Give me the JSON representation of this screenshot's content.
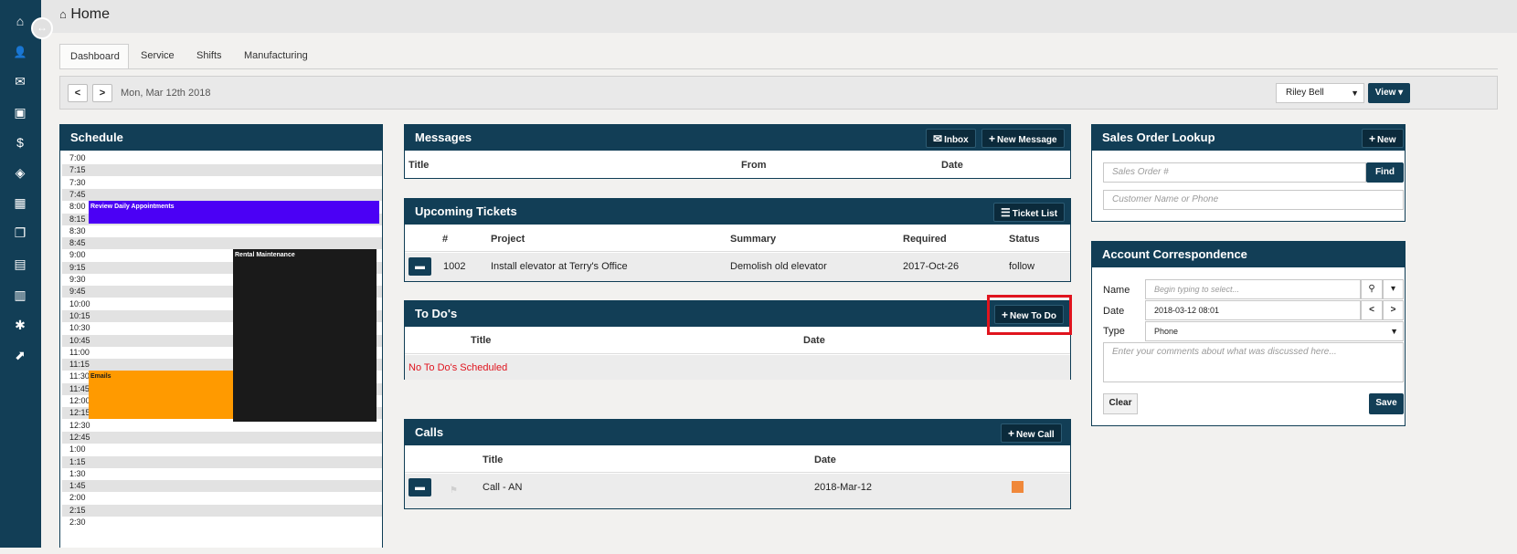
{
  "sidebar": {
    "icons": [
      "home-icon",
      "user-icon",
      "message-icon",
      "contact-icon",
      "dollar-icon",
      "tag-icon",
      "building-icon",
      "copy-icon",
      "chart-icon",
      "document-icon",
      "gear-icon",
      "external-link-icon"
    ],
    "glyphs": [
      "⌂",
      "👤",
      "✉",
      "▣",
      "$",
      "◈",
      "▦",
      "❐",
      "▤",
      "▥",
      "✱",
      "⬈"
    ],
    "collapse_glyph": "↔"
  },
  "header": {
    "home_glyph": "⌂",
    "title": "Home"
  },
  "tabs": [
    {
      "label": "Dashboard",
      "active": true
    },
    {
      "label": "Service",
      "active": false
    },
    {
      "label": "Shifts",
      "active": false
    },
    {
      "label": "Manufacturing",
      "active": false
    }
  ],
  "toolbar": {
    "prev": "<",
    "next": ">",
    "date": "Mon, Mar 12th 2018",
    "user": "Riley Bell",
    "user_arrow": "▼",
    "view_label": "View ▾"
  },
  "schedule": {
    "title": "Schedule",
    "times": [
      "7:00",
      "7:15",
      "7:30",
      "7:45",
      "8:00",
      "8:15",
      "8:30",
      "8:45",
      "9:00",
      "9:15",
      "9:30",
      "9:45",
      "10:00",
      "10:15",
      "10:30",
      "10:45",
      "11:00",
      "11:15",
      "11:30",
      "11:45",
      "12:00",
      "12:15",
      "12:30",
      "12:45",
      "1:00",
      "1:15",
      "1:30",
      "1:45",
      "2:00",
      "2:15",
      "2:30"
    ],
    "events": [
      {
        "label": "Review Daily Appointments",
        "color": "#4b00f5",
        "text_color": "#ffffff"
      },
      {
        "label": "Rental Maintenance",
        "color": "#1a1a1a",
        "text_color": "#ffffff"
      },
      {
        "label": "Emails",
        "color": "#ff9a00",
        "text_color": "#1a1a1a"
      }
    ]
  },
  "messages": {
    "title": "Messages",
    "inbox_btn": "Inbox",
    "inbox_glyph": "✉",
    "new_btn": "New Message",
    "plus_glyph": "+",
    "columns": [
      "Title",
      "From",
      "Date"
    ]
  },
  "tickets": {
    "title": "Upcoming Tickets",
    "list_btn": "Ticket List",
    "list_glyph": "☰",
    "columns": [
      "#",
      "Project",
      "Summary",
      "Required",
      "Status"
    ],
    "rows": [
      {
        "num": "1002",
        "project": "Install elevator at Terry's Office",
        "summary": "Demolish old elevator",
        "required": "2017-Oct-26",
        "status": "follow"
      }
    ]
  },
  "todos": {
    "title": "To Do's",
    "new_btn": "New To Do",
    "columns": [
      "Title",
      "Date"
    ],
    "empty": "No To Do's Scheduled"
  },
  "calls": {
    "title": "Calls",
    "new_btn": "New Call",
    "columns": [
      "Title",
      "Date"
    ],
    "rows": [
      {
        "title": "Call - AN",
        "date": "2018-Mar-12",
        "color": "#f0883a"
      }
    ]
  },
  "sales": {
    "title": "Sales Order Lookup",
    "new_btn": "New",
    "order_placeholder": "Sales Order #",
    "find_btn": "Find",
    "customer_placeholder": "Customer Name or Phone"
  },
  "account": {
    "title": "Account Correspondence",
    "name_label": "Name",
    "name_placeholder": "Begin typing to select...",
    "date_label": "Date",
    "date_value": "2018-03-12 08:01",
    "type_label": "Type",
    "type_value": "Phone",
    "type_arrow": "▼",
    "comment_placeholder": "Enter your comments about what was discussed here...",
    "clear_btn": "Clear",
    "save_btn": "Save",
    "search_glyph": "⚲",
    "caret_glyph": "▾",
    "prev": "<",
    "next": ">"
  }
}
